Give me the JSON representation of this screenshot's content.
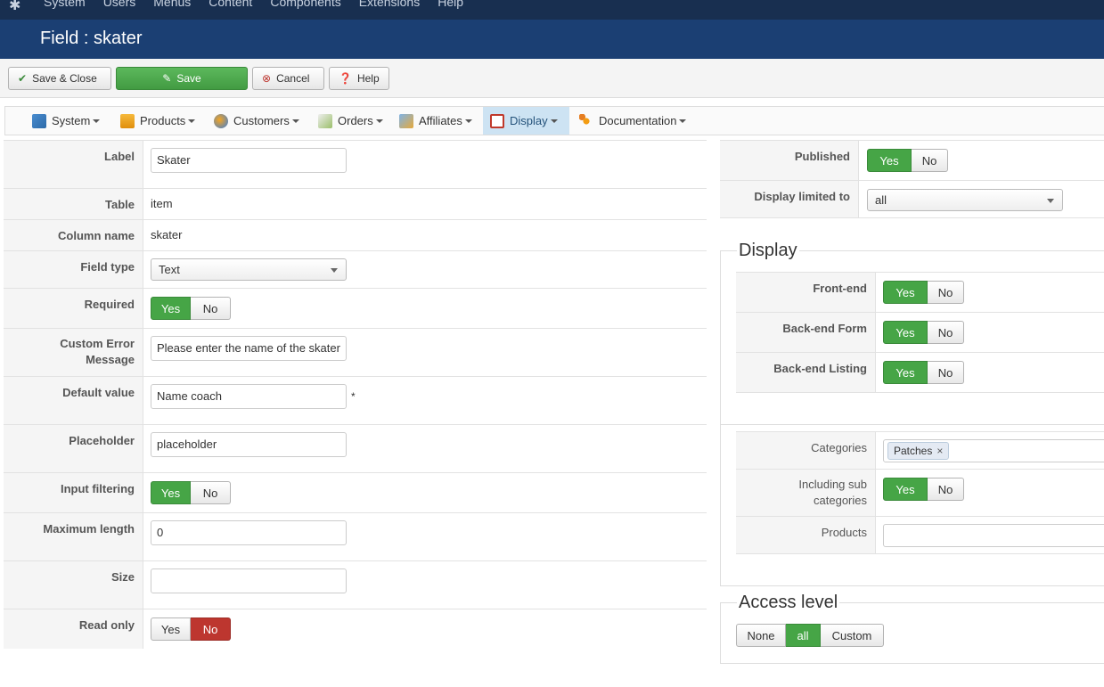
{
  "topnav": {
    "items": [
      "System",
      "Users",
      "Menus",
      "Content",
      "Components",
      "Extensions",
      "Help"
    ]
  },
  "title": "Field : skater",
  "toolbar": {
    "save_close": "Save & Close",
    "save": "Save",
    "cancel": "Cancel",
    "help": "Help"
  },
  "component_menu": [
    "System",
    "Products",
    "Customers",
    "Orders",
    "Affiliates",
    "Display",
    "Documentation"
  ],
  "form": {
    "label": {
      "label": "Label",
      "value": "Skater"
    },
    "table": {
      "label": "Table",
      "value": "item"
    },
    "column": {
      "label": "Column name",
      "value": "skater"
    },
    "field_type": {
      "label": "Field type",
      "value": "Text"
    },
    "required": {
      "label": "Required",
      "yes": "Yes",
      "no": "No"
    },
    "custom_error": {
      "label_1": "Custom Error",
      "label_2": "Message",
      "value": "Please enter the name of the skater"
    },
    "default_value": {
      "label": "Default value",
      "value": "Name coach",
      "marker": "*"
    },
    "placeholder": {
      "label": "Placeholder",
      "value": "placeholder"
    },
    "input_filtering": {
      "label": "Input filtering",
      "yes": "Yes",
      "no": "No"
    },
    "max_length": {
      "label": "Maximum length",
      "value": "0"
    },
    "size": {
      "label": "Size",
      "value": ""
    },
    "read_only": {
      "label": "Read only",
      "yes": "Yes",
      "no": "No"
    }
  },
  "right": {
    "published": {
      "label": "Published",
      "yes": "Yes",
      "no": "No"
    },
    "display_limited": {
      "label": "Display limited to",
      "value": "all"
    },
    "display_legend": "Display",
    "frontend": {
      "label": "Front-end",
      "yes": "Yes",
      "no": "No"
    },
    "backend_form": {
      "label": "Back-end Form",
      "yes": "Yes",
      "no": "No"
    },
    "backend_listing": {
      "label": "Back-end Listing",
      "yes": "Yes",
      "no": "No"
    },
    "categories": {
      "label": "Categories",
      "chip": "Patches",
      "chip_remove": "×"
    },
    "including_sub": {
      "label_1": "Including sub",
      "label_2": "categories",
      "yes": "Yes",
      "no": "No"
    },
    "products": {
      "label": "Products",
      "value": ""
    },
    "access_legend": "Access level",
    "access": [
      "None",
      "all",
      "Custom"
    ]
  },
  "colors": {
    "topnav": "#182f50",
    "titlebar": "#1b3f73",
    "green": "#46a546",
    "red": "#bd362f"
  }
}
